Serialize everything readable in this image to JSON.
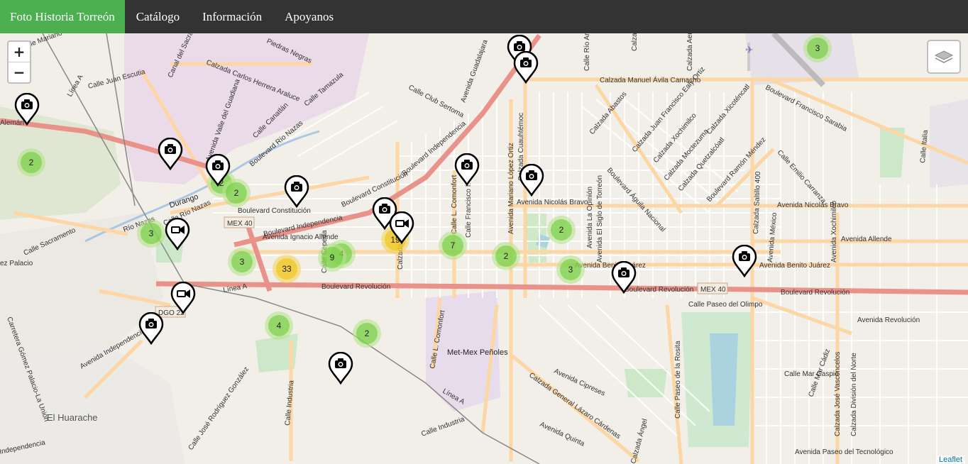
{
  "navbar": {
    "brand": "Foto Historia Torreón",
    "links": [
      "Catálogo",
      "Información",
      "Apoyanos"
    ]
  },
  "map_controls": {
    "zoom_in": "+",
    "zoom_out": "−",
    "layers_icon": "layers-icon"
  },
  "attribution": "Leaflet",
  "colors": {
    "navbar_bg": "#333333",
    "brand_bg": "#4caf50",
    "cluster_small": "#6ecc39",
    "cluster_medium": "#f0c20c",
    "major_road": "#e8928a",
    "secondary_road": "#fcd6a4"
  },
  "clusters": [
    {
      "count": "3",
      "size": "small"
    },
    {
      "count": "2",
      "size": "small"
    },
    {
      "count": "2",
      "size": "small"
    },
    {
      "count": "2",
      "size": "small"
    },
    {
      "count": "3",
      "size": "small"
    },
    {
      "count": "3",
      "size": "small"
    },
    {
      "count": "33",
      "size": "medium"
    },
    {
      "count": "4",
      "size": "small"
    },
    {
      "count": "9",
      "size": "small"
    },
    {
      "count": "19",
      "size": "medium"
    },
    {
      "count": "7",
      "size": "small"
    },
    {
      "count": "2",
      "size": "small"
    },
    {
      "count": "2",
      "size": "small"
    },
    {
      "count": "3",
      "size": "small"
    },
    {
      "count": "4",
      "size": "small"
    },
    {
      "count": "2",
      "size": "small"
    }
  ],
  "markers": [
    {
      "type": "photo",
      "icon": "camera-icon"
    },
    {
      "type": "photo",
      "icon": "camera-icon"
    },
    {
      "type": "photo",
      "icon": "camera-icon"
    },
    {
      "type": "photo",
      "icon": "camera-icon"
    },
    {
      "type": "photo",
      "icon": "camera-icon"
    },
    {
      "type": "photo",
      "icon": "camera-icon"
    },
    {
      "type": "photo",
      "icon": "camera-icon"
    },
    {
      "type": "photo",
      "icon": "camera-icon"
    },
    {
      "type": "photo",
      "icon": "camera-icon"
    },
    {
      "type": "photo",
      "icon": "camera-icon"
    },
    {
      "type": "photo",
      "icon": "camera-icon"
    },
    {
      "type": "video",
      "icon": "video-camera-icon"
    },
    {
      "type": "video",
      "icon": "video-camera-icon"
    },
    {
      "type": "video",
      "icon": "video-camera-icon"
    },
    {
      "type": "photo",
      "icon": "camera-icon"
    },
    {
      "type": "photo",
      "icon": "camera-icon"
    }
  ],
  "map_labels": {
    "calzada_manuel_avila_camacho": "Calzada Manuel Ávila Camacho",
    "boulevard_independencia": "Boulevard Independencia",
    "boulevard_constitucion": "Boulevard Constitución",
    "boulevard_revolucion": "Boulevard Revolución",
    "boulevard_revolucion_2": "Boulevard Revolución",
    "boulevard_revolucion_3": "Boulevard Revolución",
    "avenida_ignacio_allende": "Avenida Ignacio Allende",
    "avenida_nicolas_bravo": "Avenida Nicolás Bravo",
    "avenida_nicolas_bravo_2": "Avenida Nicolás Bravo",
    "avenida_allende": "Avenida Allende",
    "avenida_benito_juarez": "Avenida Benito Juárez",
    "avenida_benito_juarez_2": "Avenida Benito Juárez",
    "avenida_revolucion": "Avenida Revolución",
    "calle_paseo_del_olimpo": "Calle Paseo del Olimpo",
    "calzada_general_lazaro_cardenas": "Calzada General Lázaro Cárdenas",
    "avenida_cipreses": "Avenida Cipreses",
    "avenida_quinta": "Avenida Quinta",
    "calle_industria": "Calle Industria",
    "calle_industria_2": "Calle Industria",
    "el_huarache": "El Huarache",
    "avenida_independencia": "Avenida Independencia",
    "boulevard_rio_nazas": "Boulevard Río Nazas",
    "calle_sacramento": "Calle Sacramento",
    "calzada_carlos_herrera_araluce": "Calzada Carlos Herrera Araluce",
    "calle_club_sertoma": "Calle Club Sertoma",
    "avenida_guadalajara": "Avenida Guadalajara",
    "boulevard_aguila_nacional": "Boulevard Águila Nacional",
    "calzada_saltillo_400": "Calzada Saltillo 400",
    "boulevard_francisco_sarabia": "Boulevard Francisco Sarabia",
    "boulevard_ramon_mendez": "Boulevard Ramón Méndez",
    "calzada_abastos": "Calzada Abastos",
    "met_mex_penoles": "Met-Mex Peñoles",
    "durango": "Durango",
    "rio_nazas": "Río Nazas",
    "mex_40": "MEX 40",
    "mex_40_2": "MEX 40",
    "dgo_22": "DGO 22",
    "linea_a": "Línea A",
    "linea_a_2": "Línea A",
    "aleman": "Alemán",
    "calle_juan_escutia": "Calle Juan Escutia",
    "canal_del_sacramento": "Canal del Sacramento",
    "calle_tamazula": "Calle Tamazula",
    "avenida_valle_del_guadiana": "Avenida Valle del Guadiana",
    "calle_canatlan": "Calle Canatlán",
    "calle_rio_nazas": "Calle Río Nazas",
    "calzada_cuauhtemoc": "Calzada Cuauhtémoc",
    "avenida_mariano_lopez_ortiz": "Avenida Mariano López Ortiz",
    "calle_francisco_i_madero": "Calle Francisco I. Madero",
    "calle_l_comonfort": "Calle L. Comonfort",
    "calle_l_comonfort_2": "Calle L. Comonfort",
    "avenida_la_opinion": "Avenida La Opinión",
    "avenida_el_siglo_de_torreon": "Avenida El Siglo de Torreón",
    "calle_paseo_de_la_rosita": "Calle Paseo de la Rosita",
    "calzada_jose_vasconcelos": "Calzada José Vasconcelos",
    "calzada_division_del_norte": "Calzada División del Norte",
    "calle_mar_caspio": "Calle Mar Caspio",
    "calle_italia": "Calle Italia",
    "calle_emilio_carranza": "Calle Emilio Carranza",
    "avenida_mexico": "Avenida México",
    "calle_jose_rodriguez_gonzalez": "Calle José Rodríguez González",
    "carretera_gomez_palacio_la_union": "Carretera Gómez Palacio-La Unión",
    "independencia": "Independencia",
    "avenida_paseo_del_tecnologico": "Avenida Paseo del Tecnológico",
    "calle_mariano_urrea": "Calle Mariano Urrea",
    "piedras_negras": "Piedras Negras",
    "calzada_juan_francisco_ealy_ortiz": "Calzada Juan Francisco Ealy Ortiz",
    "calzada_xochimilco": "Calzada Xochimilco",
    "calzada_xicotencatl": "Calzada Xicoténcatl",
    "calzada_moctezuma": "Calzada Moctezuma",
    "calzada_quetzalcoatl": "Calzada Quetzalcóatl",
    "calle_mar_cadiz": "Calle Mar Cádiz",
    "ez_palacio": "ez Palacio",
    "calle_rio_nazas_2": "Calle Río Nazas",
    "calzada_aero": "Calzada Aero",
    "calle_rio_aram": "Calle Río Aram",
    "calzada": "Calzada",
    "calzada_cuauhtemoc_2": "Calzada Cuauhtémoc",
    "calzada_colon": "Calzada Colón",
    "calle_cepeda": "Calle Cepeda",
    "calle_galeana": "Calle Galeana",
    "avenida_xochimilco": "Avenida Xochimilco",
    "calzada_angel": "Calzada Ángel"
  }
}
